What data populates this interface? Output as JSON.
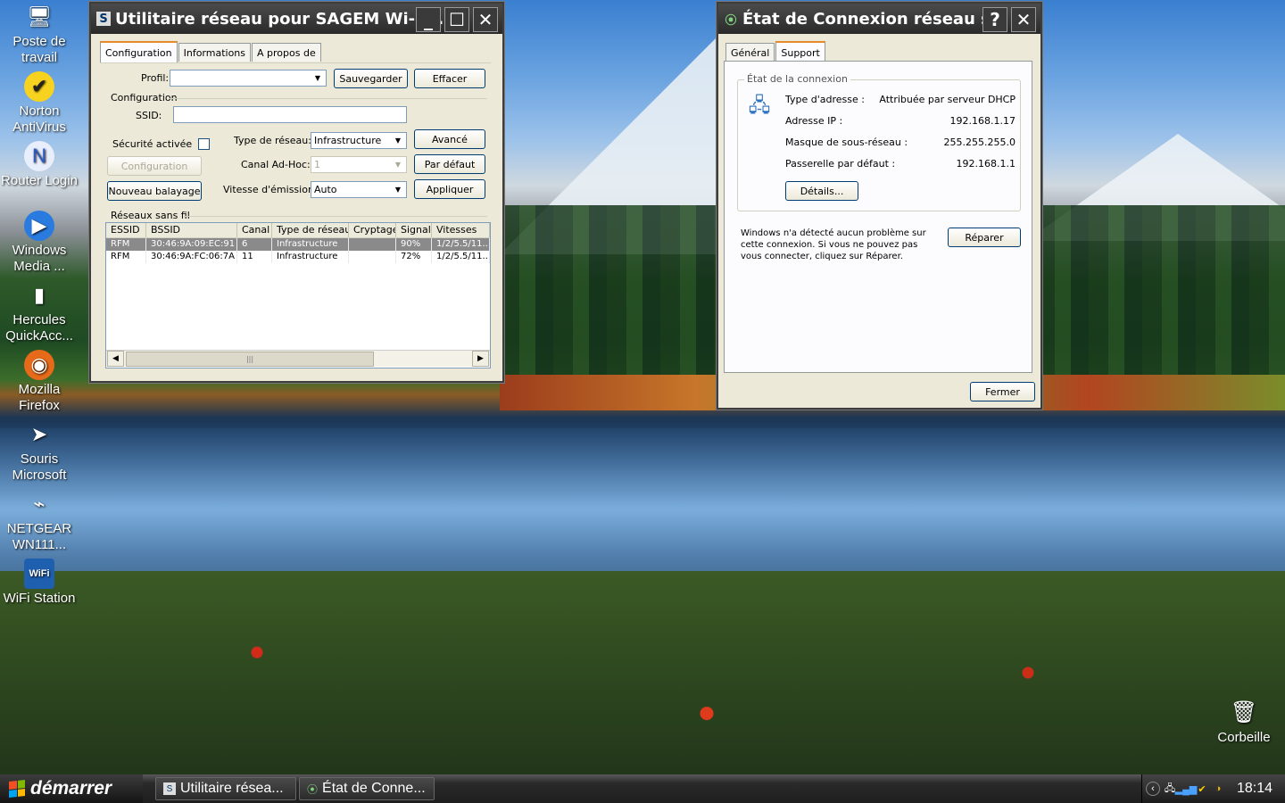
{
  "desktop": {
    "icons": [
      {
        "label": "Poste de travail",
        "icon": "computer-icon",
        "glyph": "🖥"
      },
      {
        "label": "Norton AntiVirus",
        "icon": "norton-icon",
        "glyph": "✔"
      },
      {
        "label": "Router Login",
        "icon": "router-login-icon",
        "glyph": "N"
      },
      {
        "label": "Windows Media ...",
        "icon": "media-player-icon",
        "glyph": "▶"
      },
      {
        "label": "Hercules QuickAcc...",
        "icon": "hercules-icon",
        "glyph": "▮"
      },
      {
        "label": "Mozilla Firefox",
        "icon": "firefox-icon",
        "glyph": "◉"
      },
      {
        "label": "Souris Microsoft",
        "icon": "mouse-pointer-icon",
        "glyph": "➤"
      },
      {
        "label": "NETGEAR WN111...",
        "icon": "netgear-icon",
        "glyph": "⌁"
      },
      {
        "label": "WiFi Station",
        "icon": "wifi-station-icon",
        "glyph": "WiFi"
      }
    ],
    "recycle_bin": {
      "label": "Corbeille",
      "icon": "recycle-bin-icon"
    }
  },
  "sagem": {
    "title": "Utilitaire réseau pour SAGEM Wi-Fi...",
    "tabs": [
      "Configuration",
      "Informations",
      "A propos de"
    ],
    "profile_label": "Profil:",
    "profile_value": "",
    "save_button": "Sauvegarder",
    "delete_button": "Effacer",
    "config_group": "Configuration",
    "ssid_label": "SSID:",
    "ssid_value": "",
    "security_label": "Sécurité activée",
    "config_button": "Configuration",
    "rescan_button": "Nouveau balayage",
    "network_type_label": "Type de réseau:",
    "network_type_value": "Infrastructure",
    "adhoc_channel_label": "Canal Ad-Hoc:",
    "adhoc_channel_value": "1",
    "tx_rate_label": "Vitesse d'émission:",
    "tx_rate_value": "Auto",
    "advanced_button": "Avancé",
    "default_button": "Par défaut",
    "apply_button": "Appliquer",
    "networks_group": "Réseaux sans fil",
    "columns": [
      "ESSID",
      "BSSID",
      "Canal",
      "Type de réseau",
      "Cryptage",
      "Signal",
      "Vitesses"
    ],
    "rows": [
      {
        "essid": "RFM",
        "bssid": "30:46:9A:09:EC:91",
        "canal": "6",
        "type": "Infrastructure",
        "cryptage": "",
        "signal": "90%",
        "vitesses": "1/2/5.5/11..."
      },
      {
        "essid": "RFM",
        "bssid": "30:46:9A:FC:06:7A",
        "canal": "11",
        "type": "Infrastructure",
        "cryptage": "",
        "signal": "72%",
        "vitesses": "1/2/5.5/11..."
      }
    ]
  },
  "etat": {
    "title": "État de Connexion réseau s...",
    "tabs": [
      "Général",
      "Support"
    ],
    "group_title": "État de la connexion",
    "address_type_label": "Type d'adresse :",
    "address_type_value": "Attribuée par serveur DHCP",
    "ip_label": "Adresse IP :",
    "ip_value": "192.168.1.17",
    "mask_label": "Masque de sous-réseau :",
    "mask_value": "255.255.255.0",
    "gateway_label": "Passerelle par défaut :",
    "gateway_value": "192.168.1.1",
    "details_button": "Détails...",
    "repair_text": "Windows n'a détecté aucun problème sur cette connexion. Si vous ne pouvez pas vous connecter, cliquez sur Réparer.",
    "repair_button": "Réparer",
    "close_button": "Fermer"
  },
  "taskbar": {
    "start_label": "démarrer",
    "items": [
      "Utilitaire résea...",
      "État de Conne..."
    ],
    "clock": "18:14"
  }
}
